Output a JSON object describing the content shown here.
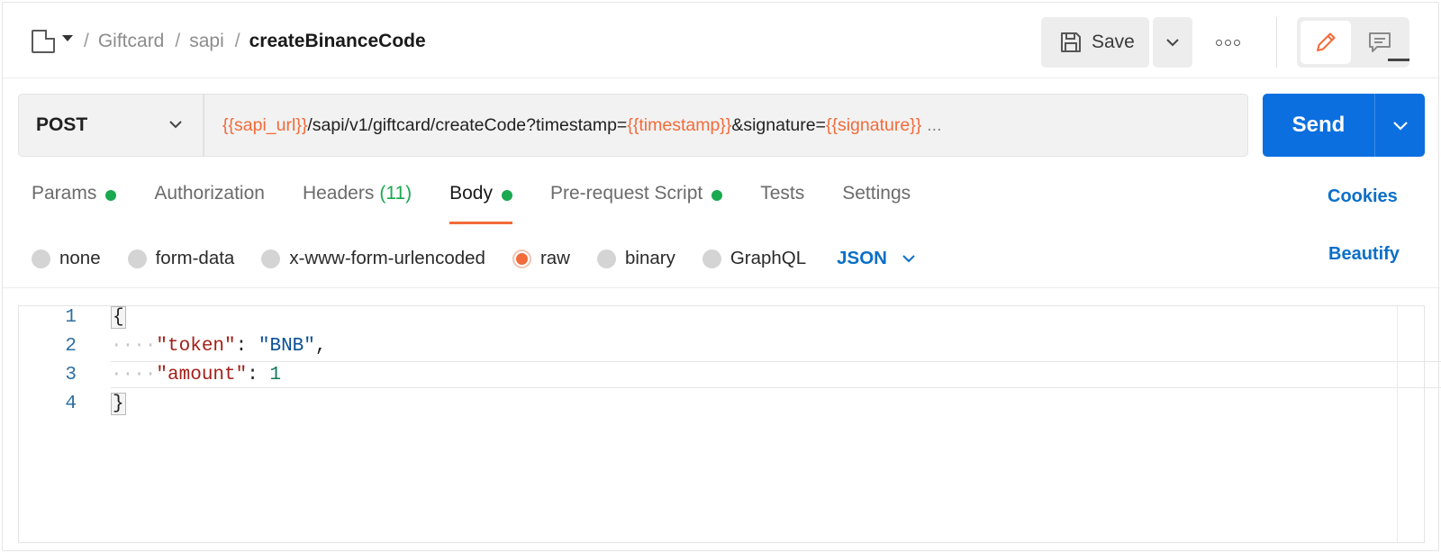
{
  "breadcrumb": {
    "items": [
      "Giftcard",
      "sapi",
      "createBinanceCode"
    ],
    "separator": "/"
  },
  "toolbar": {
    "save_label": "Save"
  },
  "request": {
    "method": "POST",
    "url_parts": [
      {
        "text": "{{sapi_url}}",
        "kind": "var"
      },
      {
        "text": "/sapi/v1/giftcard/createCode?timestamp=",
        "kind": "plain"
      },
      {
        "text": "{{timestamp}}",
        "kind": "var"
      },
      {
        "text": "&signature=",
        "kind": "plain"
      },
      {
        "text": "{{signature}}",
        "kind": "var"
      }
    ],
    "url_overflow": "...",
    "send_label": "Send"
  },
  "tabs": [
    {
      "label": "Params",
      "dot": true
    },
    {
      "label": "Authorization"
    },
    {
      "label": "Headers",
      "count": "(11)"
    },
    {
      "label": "Body",
      "dot": true,
      "active": true
    },
    {
      "label": "Pre-request Script",
      "dot": true
    },
    {
      "label": "Tests"
    },
    {
      "label": "Settings"
    }
  ],
  "cookies_label": "Cookies",
  "body_types": [
    {
      "label": "none"
    },
    {
      "label": "form-data"
    },
    {
      "label": "x-www-form-urlencoded"
    },
    {
      "label": "raw",
      "selected": true
    },
    {
      "label": "binary"
    },
    {
      "label": "GraphQL"
    }
  ],
  "raw_language": "JSON",
  "beautify_label": "Beautify",
  "editor": {
    "line_numbers": [
      "1",
      "2",
      "3",
      "4"
    ],
    "open_brace": "{",
    "close_brace": "}",
    "token_key": "\"token\"",
    "token_value": "\"BNB\"",
    "amount_key": "\"amount\"",
    "amount_value": "1",
    "whitespace_marker": "····"
  },
  "colors": {
    "accent": "#f26b3a",
    "primary": "#0b6fe0",
    "status_green": "#19a94f",
    "link_blue": "#0b6fc8"
  },
  "icons": [
    "collection-icon",
    "caret-down-icon",
    "save-icon",
    "chevron-down-icon",
    "more-icon",
    "edit-pencil-icon",
    "comment-icon"
  ]
}
